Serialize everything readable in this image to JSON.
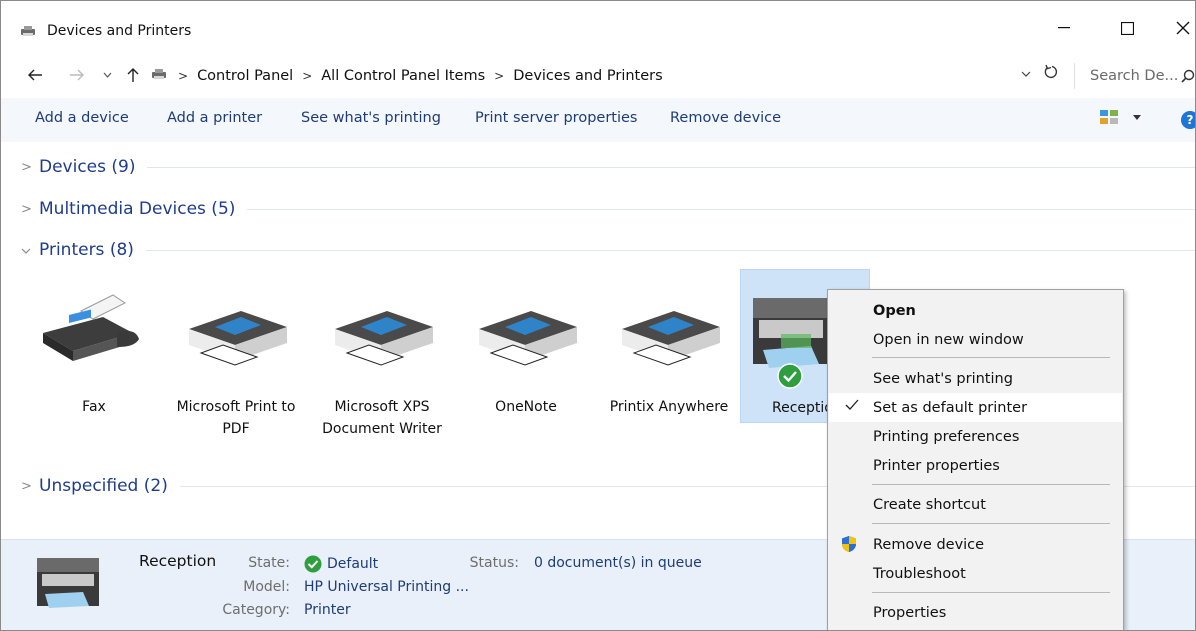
{
  "window": {
    "title": "Devices and Printers"
  },
  "address": {
    "crumbs": [
      "Control Panel",
      "All Control Panel Items",
      "Devices and Printers"
    ],
    "search_placeholder": "Search De..."
  },
  "toolbar": {
    "add_device": "Add a device",
    "add_printer": "Add a printer",
    "see_printing": "See what's printing",
    "server_props": "Print server properties",
    "remove_device": "Remove device"
  },
  "groups": {
    "devices": "Devices (9)",
    "multimedia": "Multimedia Devices (5)",
    "printers": "Printers (8)",
    "unspecified": "Unspecified (2)"
  },
  "printers": [
    {
      "label": "Fax",
      "icon": "fax-icon"
    },
    {
      "label": "Microsoft Print to PDF",
      "icon": "printer-icon"
    },
    {
      "label": "Microsoft XPS Document Writer",
      "icon": "printer-icon"
    },
    {
      "label": "OneNote",
      "icon": "printer-icon"
    },
    {
      "label": "Printix Anywhere",
      "icon": "printer-icon"
    },
    {
      "label": "Receptio",
      "icon": "mfp-printer-icon",
      "selected": true,
      "default": true
    }
  ],
  "context_menu": {
    "open": "Open",
    "open_new_window": "Open in new window",
    "see_printing": "See what's printing",
    "set_default": "Set as default printer",
    "preferences": "Printing preferences",
    "printer_properties": "Printer properties",
    "create_shortcut": "Create shortcut",
    "remove_device": "Remove device",
    "troubleshoot": "Troubleshoot",
    "properties": "Properties"
  },
  "details": {
    "name": "Reception",
    "state_key": "State:",
    "state_val": "Default",
    "model_key": "Model:",
    "model_val": "HP Universal Printing ...",
    "category_key": "Category:",
    "category_val": "Printer",
    "status_key": "Status:",
    "status_val": "0 document(s) in queue"
  },
  "colors": {
    "link": "#1e3c78",
    "group_label": "#1e3c8c",
    "selection": "#cfe3f8",
    "menu_bg": "#f2f2f2",
    "default_check": "#2e9e3e"
  }
}
